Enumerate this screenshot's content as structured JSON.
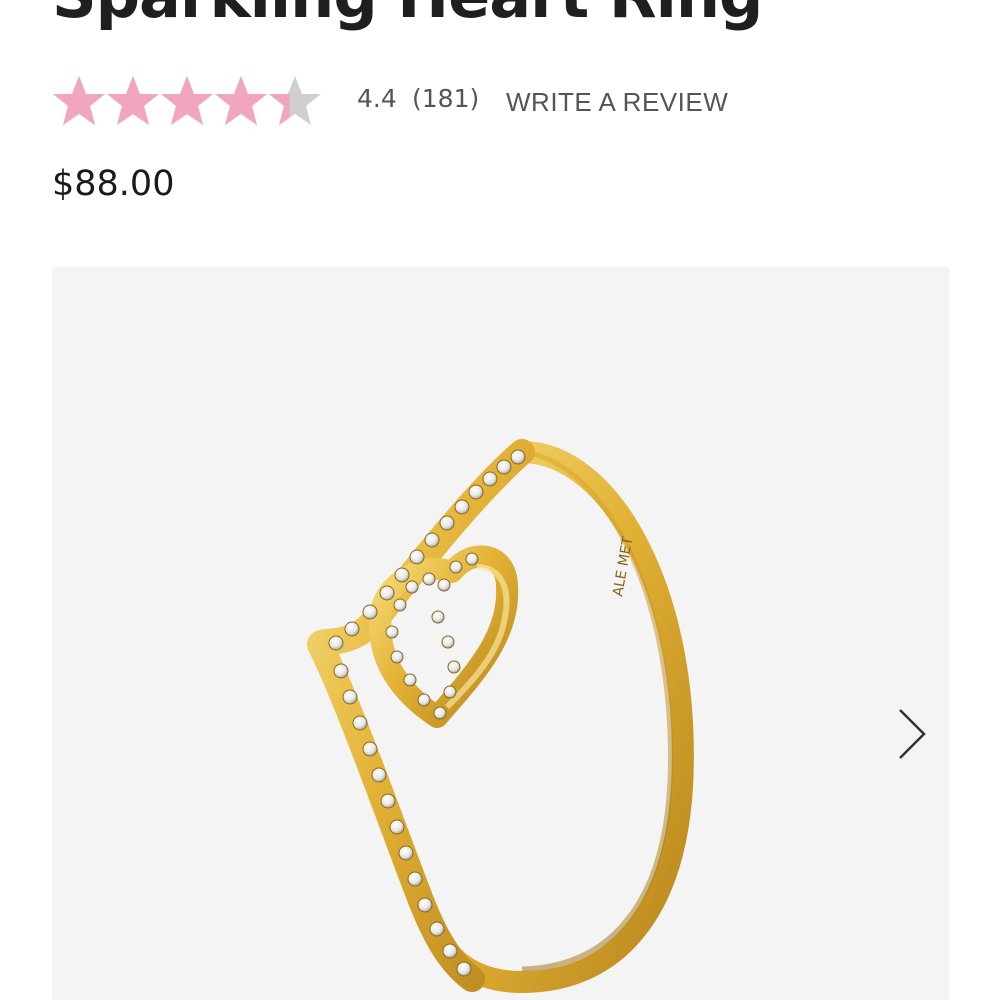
{
  "product": {
    "title": "Sparkling Heart Ring",
    "price": "$88.00"
  },
  "rating": {
    "value": "4.4",
    "count": "(181)",
    "score": 4.4,
    "max": 5,
    "filled_color": "#f2a6be",
    "empty_color": "#cfcfcf",
    "write_review_label": "WRITE A REVIEW"
  },
  "gallery": {
    "background": "#f4f4f4",
    "image_icon": "ring-photo",
    "engraving": "ALE MET",
    "next_icon": "chevron-right-icon"
  }
}
